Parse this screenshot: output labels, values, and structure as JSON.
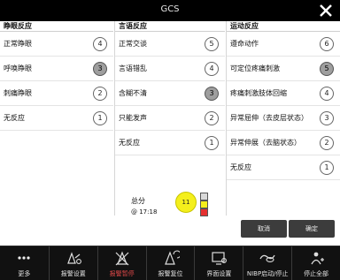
{
  "dialog": {
    "title": "GCS",
    "columns": [
      {
        "header": "睁眼反应",
        "rows": [
          {
            "label": "正常睁眼",
            "score": "4",
            "selected": false
          },
          {
            "label": "呼唤睁眼",
            "score": "3",
            "selected": true
          },
          {
            "label": "刺痛睁眼",
            "score": "2",
            "selected": false
          },
          {
            "label": "无反应",
            "score": "1",
            "selected": false
          }
        ]
      },
      {
        "header": "言语反应",
        "rows": [
          {
            "label": "正常交谈",
            "score": "5",
            "selected": false
          },
          {
            "label": "言语错乱",
            "score": "4",
            "selected": false
          },
          {
            "label": "含糊不清",
            "score": "3",
            "selected": true
          },
          {
            "label": "只能发声",
            "score": "2",
            "selected": false
          },
          {
            "label": "无反应",
            "score": "1",
            "selected": false
          }
        ]
      },
      {
        "header": "运动反应",
        "rows": [
          {
            "label": "遵命动作",
            "score": "6",
            "selected": false
          },
          {
            "label": "可定位疼痛刺激",
            "score": "5",
            "selected": true
          },
          {
            "label": "疼痛刺激肢体回缩",
            "score": "4",
            "selected": false
          },
          {
            "label": "异常屈伸（去皮层状态）",
            "score": "3",
            "selected": false
          },
          {
            "label": "异常伸展（去脑状态）",
            "score": "2",
            "selected": false
          },
          {
            "label": "无反应",
            "score": "1",
            "selected": false
          }
        ]
      }
    ],
    "total": {
      "label": "总分",
      "time": "@ 17:18",
      "value": "11",
      "indicator_color": "#f4ef1c",
      "scale_colors": [
        "#d9d9d9",
        "#f4ef1c",
        "#e53030"
      ]
    },
    "buttons": {
      "cancel": "取消",
      "confirm": "确定"
    }
  },
  "toolbar": [
    {
      "label": "更多",
      "icon": "more-dots-icon",
      "name": "more"
    },
    {
      "label": "报警设置",
      "icon": "alarm-setup-icon",
      "name": "alarm-setup"
    },
    {
      "label": "报警暂停",
      "icon": "alarm-pause-icon",
      "name": "alarm-pause"
    },
    {
      "label": "报警复位",
      "icon": "alarm-reset-icon",
      "name": "alarm-reset"
    },
    {
      "label": "界面设置",
      "icon": "screen-setup-icon",
      "name": "screen-setup"
    },
    {
      "label": "NIBP启动/停止",
      "icon": "nibp-cuff-icon",
      "name": "nibp-start-stop"
    },
    {
      "label": "停止全部",
      "icon": "stop-all-icon",
      "name": "stop-all"
    }
  ]
}
